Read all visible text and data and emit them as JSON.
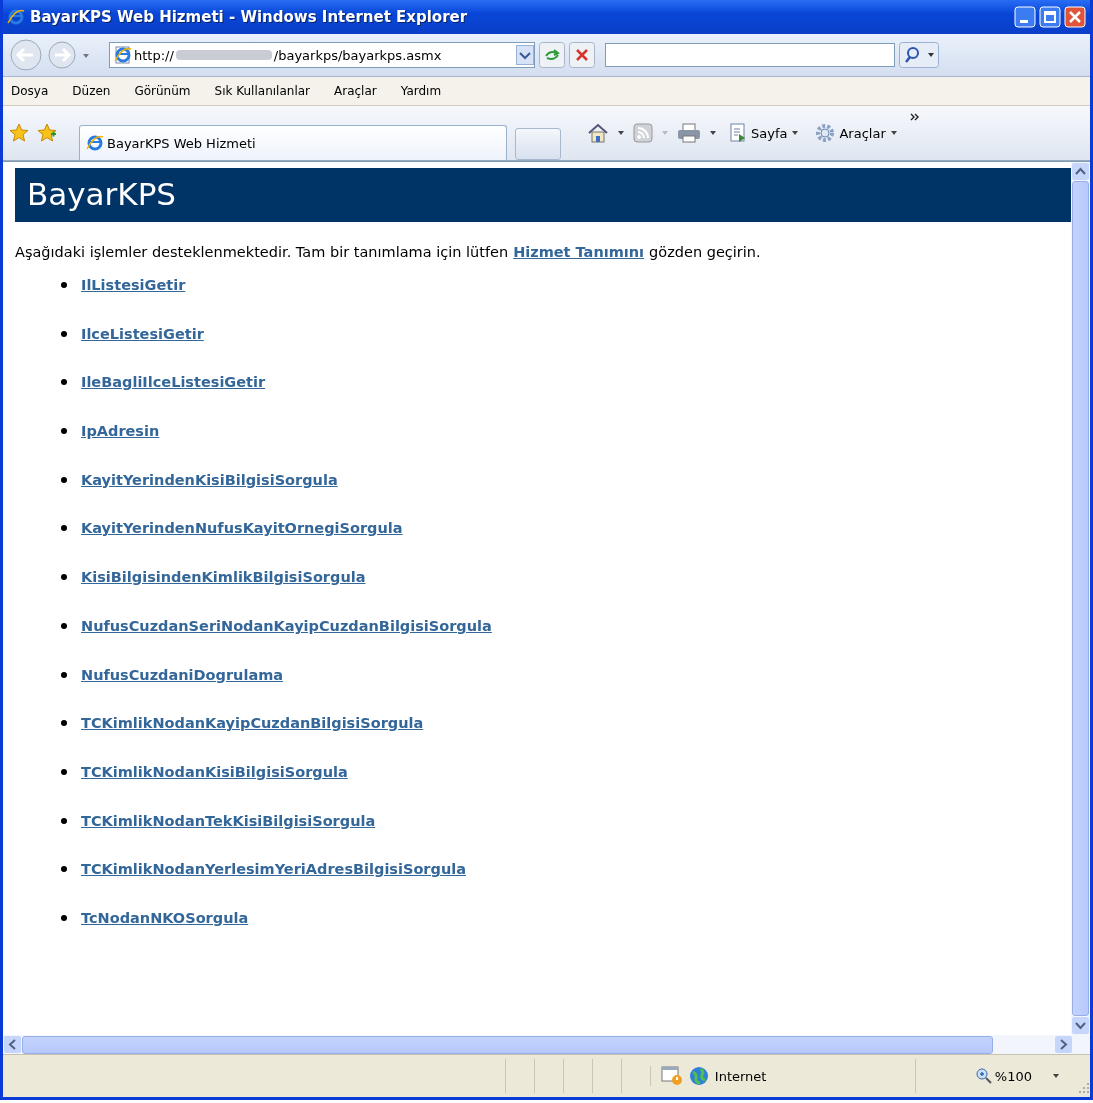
{
  "window": {
    "title": "BayarKPS Web Hizmeti - Windows Internet Explorer"
  },
  "address": {
    "prefix": "http://",
    "suffix": "/bayarkps/bayarkps.asmx"
  },
  "menu": [
    "Dosya",
    "Düzen",
    "Görünüm",
    "Sık Kullanılanlar",
    "Araçlar",
    "Yardım"
  ],
  "tabs": [
    {
      "title": "BayarKPS Web Hizmeti",
      "selected": true
    }
  ],
  "command_bar": [
    {
      "kind": "page",
      "label": "Sayfa"
    },
    {
      "kind": "tools",
      "label": "Araçlar"
    }
  ],
  "page": {
    "heading": "BayarKPS",
    "intro": {
      "before": "Aşağıdaki işlemler desteklenmektedir. Tam bir tanımlama için lütfen",
      "link": "Hizmet Tanımını",
      "after": "gözden geçirin."
    },
    "operations": [
      "IlListesiGetir",
      "IlceListesiGetir",
      "IleBagliIlceListesiGetir",
      "IpAdresin",
      "KayitYerindenKisiBilgisiSorgula",
      "KayitYerindenNufusKayitOrnegiSorgula",
      "KisiBilgisindenKimlikBilgisiSorgula",
      "NufusCuzdanSeriNodanKayipCuzdanBilgisiSorgula",
      "NufusCuzdaniDogrulama",
      "TCKimlikNodanKayipCuzdanBilgisiSorgula",
      "TCKimlikNodanKisiBilgisiSorgula",
      "TCKimlikNodanTekKisiBilgisiSorgula",
      "TCKimlikNodanYerlesimYeriAdresBilgisiSorgula",
      "TcNodanNKOSorgula"
    ]
  },
  "status_bar": {
    "zone": "Internet",
    "zoom": "%100"
  }
}
